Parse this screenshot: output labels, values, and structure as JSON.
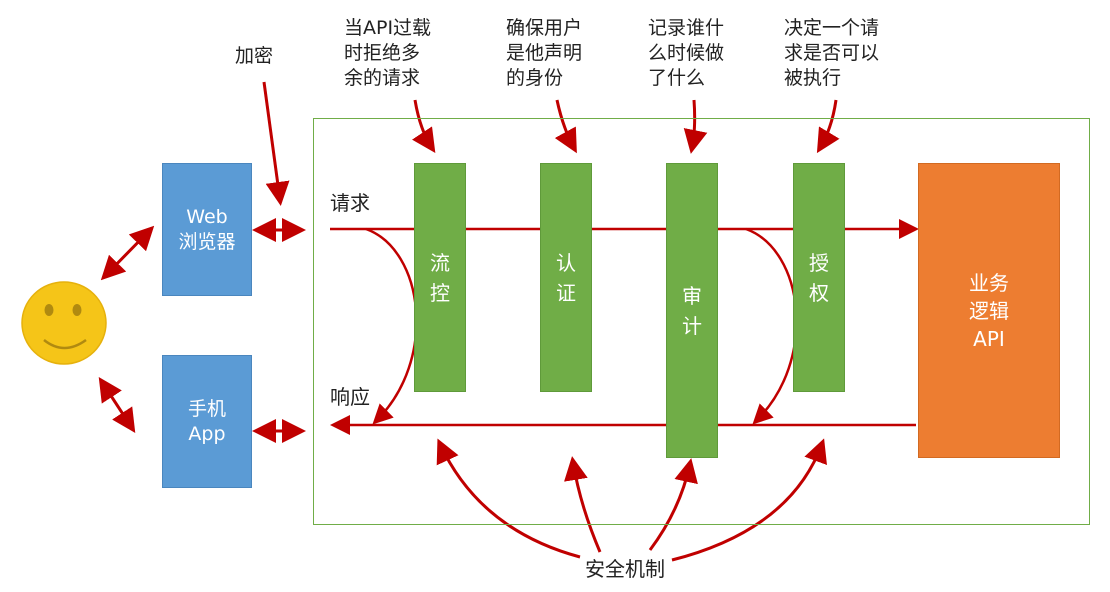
{
  "notes": {
    "encryption": "加密",
    "throttle": "当API过载\n时拒绝多\n余的请求",
    "authn": "确保用户\n是他声明\n的身份",
    "audit": "记录谁什\n么时候做\n了什么",
    "authz": "决定一个请\n求是否可以\n被执行"
  },
  "clients": {
    "web": "Web\n浏览器",
    "app": "手机\nApp"
  },
  "flow": {
    "request": "请求",
    "response": "响应"
  },
  "mechanisms": {
    "throttle": "流\n控",
    "authn": "认\n证",
    "audit": "审\n计",
    "authz": "授\n权"
  },
  "logic": "业务\n逻辑\nAPI",
  "security": "安全机制",
  "colors": {
    "arrow": "#c00000",
    "mechanism": "#70ad47",
    "client": "#5b9bd5",
    "logic": "#ed7d31",
    "face": "#f5c518"
  }
}
